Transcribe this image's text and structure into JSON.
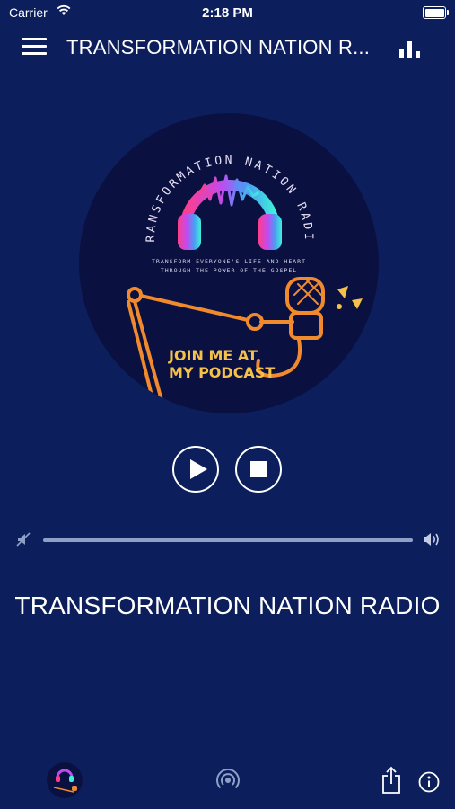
{
  "status_bar": {
    "carrier": "Carrier",
    "time": "2:18 PM"
  },
  "nav": {
    "title": "TRANSFORMATION NATION R..."
  },
  "artwork": {
    "arc_title": "TRANSFORMATION NATION RADIO",
    "tagline_line1": "TRANSFORM EVERYONE'S LIFE AND HEART",
    "tagline_line2": "THROUGH THE POWER OF THE GOSPEL",
    "cta_line1": "JOIN ME AT",
    "cta_line2": "MY PODCAST"
  },
  "player": {
    "volume_level": 1.0
  },
  "station": {
    "name": "TRANSFORMATION NATION RADIO"
  },
  "icons": {
    "menu": "hamburger-menu-icon",
    "equalizer": "equalizer-icon",
    "play": "play-icon",
    "stop": "stop-icon",
    "mute": "volume-mute-icon",
    "volume": "volume-max-icon",
    "radio": "radio-broadcast-icon",
    "share": "share-icon",
    "info": "info-icon"
  },
  "colors": {
    "background": "#0c1f5c",
    "accent_orange": "#f08a2c",
    "cta_yellow": "#f5c14a"
  }
}
